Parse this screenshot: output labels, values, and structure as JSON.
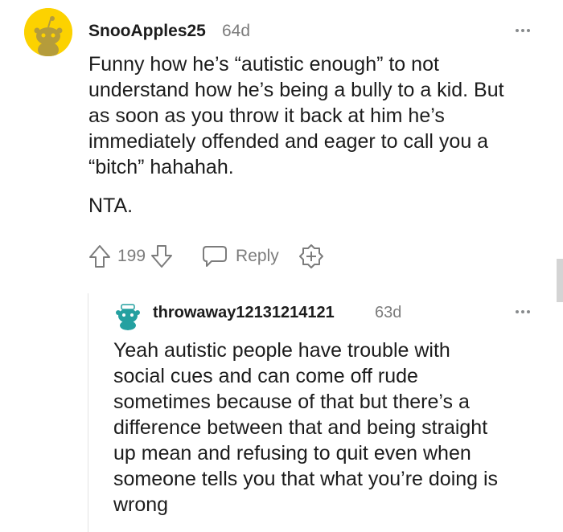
{
  "comments": [
    {
      "username": "SnooApples25",
      "age": "64d",
      "avatar_color": "#fcd200",
      "body_lines": [
        "Funny how he’s “autistic enough” to not",
        "understand how he’s being a bully to a kid. But",
        "as soon as you throw it back at him he’s",
        "immediately offended and eager to call you a",
        "“bitch” hahahah."
      ],
      "body_p2": "NTA.",
      "score": "199",
      "reply_label": "Reply",
      "icons": [
        "upvote-icon",
        "downvote-icon",
        "reply-icon",
        "award-icon",
        "more-icon"
      ]
    },
    {
      "username": "throwaway12131214121",
      "age": "63d",
      "avatar_color": "#24a0a0",
      "body_lines": [
        "Yeah autistic people have trouble with",
        "social cues and can come off rude",
        "sometimes because of that but there’s a",
        "difference between that and being straight",
        "up mean and refusing to quit even when",
        "someone tells you that what you’re doing is",
        "wrong"
      ]
    }
  ]
}
